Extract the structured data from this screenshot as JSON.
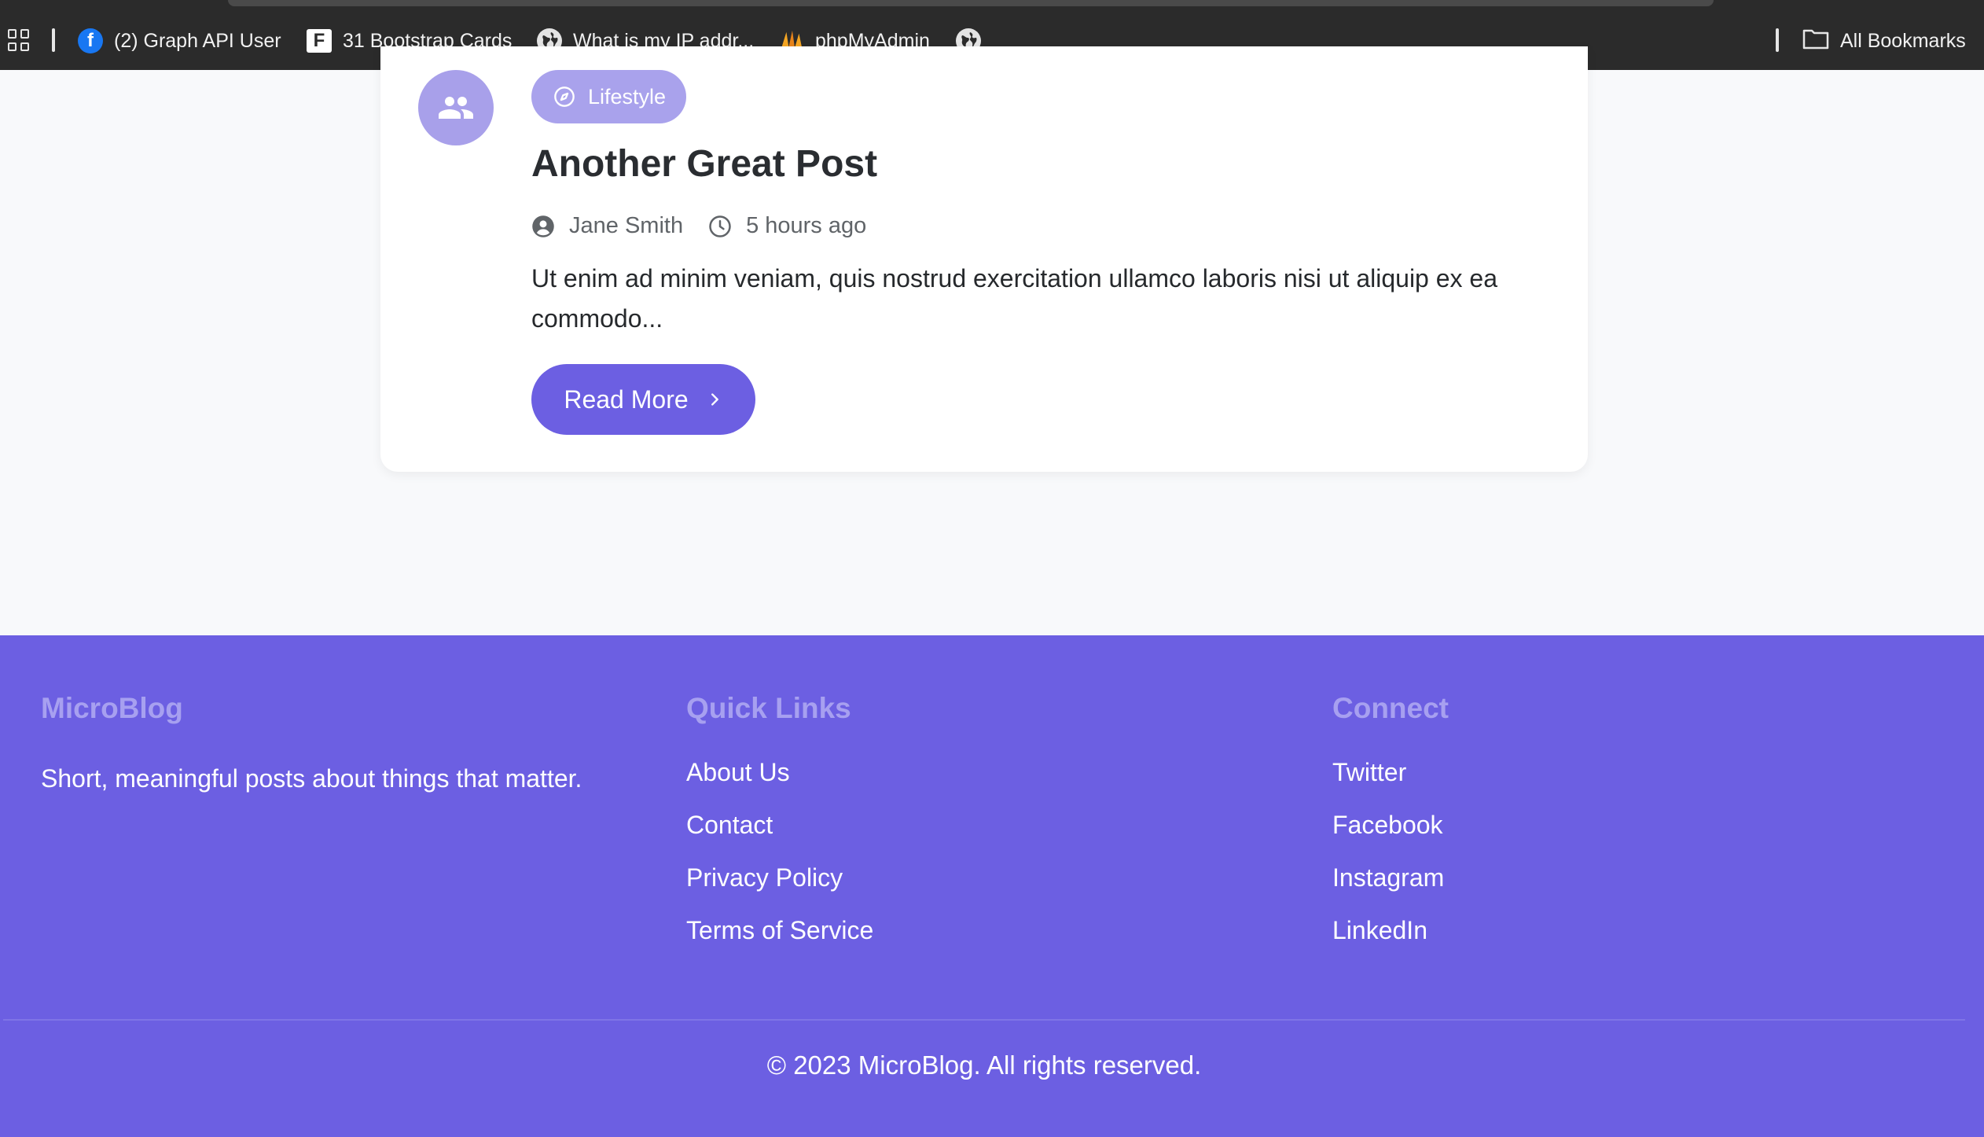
{
  "bookmarks": {
    "items": [
      {
        "label": "(2) Graph API User",
        "icon": "facebook-icon"
      },
      {
        "label": "31 Bootstrap Cards",
        "icon": "formstack-f-icon"
      },
      {
        "label": "What is my IP addr...",
        "icon": "globe-icon"
      },
      {
        "label": "phpMyAdmin",
        "icon": "phpmyadmin-icon"
      },
      {
        "label": "",
        "icon": "globe-icon"
      }
    ],
    "all_bookmarks_label": "All Bookmarks"
  },
  "post": {
    "category": "Lifestyle",
    "title": "Another Great Post",
    "author": "Jane Smith",
    "time": "5 hours ago",
    "excerpt": "Ut enim ad minim veniam, quis nostrud exercitation ullamco laboris nisi ut aliquip ex ea commodo...",
    "read_more_label": "Read More"
  },
  "footer": {
    "brand": {
      "title": "MicroBlog",
      "tagline": "Short, meaningful posts about things that matter."
    },
    "quick_links": {
      "title": "Quick Links",
      "items": [
        "About Us",
        "Contact",
        "Privacy Policy",
        "Terms of Service"
      ]
    },
    "connect": {
      "title": "Connect",
      "items": [
        "Twitter",
        "Facebook",
        "Instagram",
        "LinkedIn"
      ]
    },
    "copyright": "© 2023 MicroBlog. All rights reserved."
  },
  "colors": {
    "accent": "#6c5fe2",
    "accent_light": "#a9a2ec",
    "footer_heading": "#a7a0f0",
    "bookmarks_bg": "#2b2b2b"
  }
}
